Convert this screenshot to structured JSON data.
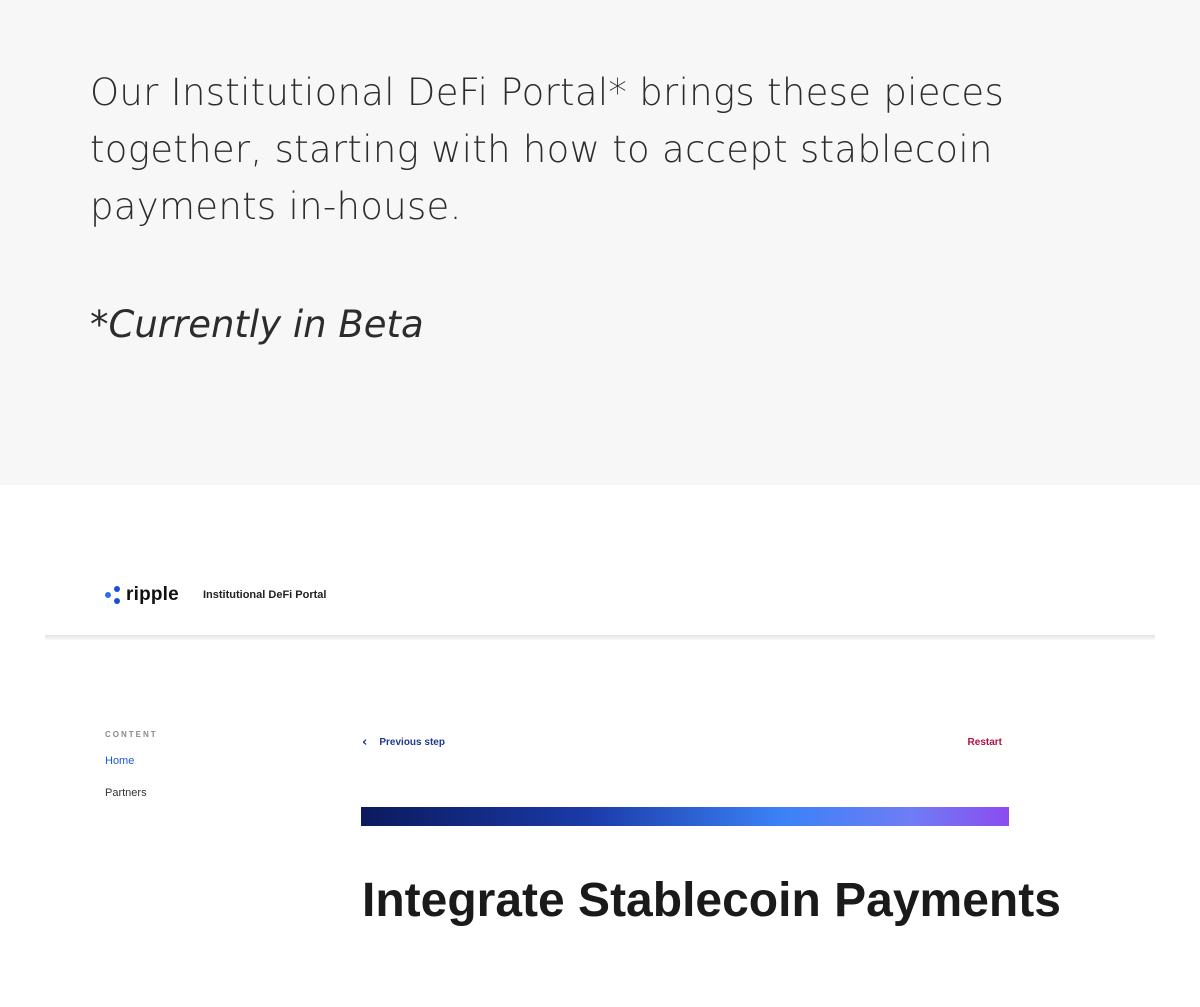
{
  "intro": {
    "text": "Our Institutional DeFi Portal* brings these pieces together, starting with how to accept stablecoin payments in-house.",
    "beta_note": "*Currently in Beta"
  },
  "portal": {
    "logo_text": "ripple",
    "logo_icon": "ripple-logo-icon",
    "name": "Institutional DeFi Portal"
  },
  "sidebar": {
    "heading": "CONTENT",
    "items": [
      {
        "label": "Home",
        "active": true
      },
      {
        "label": "Partners",
        "active": false
      }
    ]
  },
  "step_nav": {
    "chevron_icon": "chevron-left-icon",
    "previous_label": "Previous step",
    "restart_label": "Restart"
  },
  "main": {
    "title": "Integrate Stablecoin Payments"
  },
  "colors": {
    "accent": "#1f56d6",
    "restart": "#b3123f",
    "gradient_start": "#0b1a5e",
    "gradient_end": "#8b4cf0"
  }
}
